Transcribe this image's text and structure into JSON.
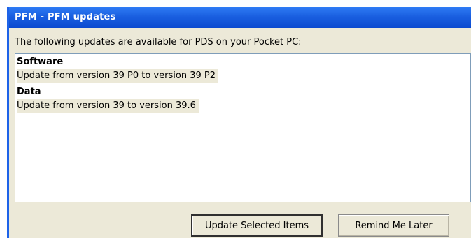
{
  "window": {
    "title": "PFM - PFM updates"
  },
  "intro_text": "The following updates are available for PDS on your Pocket PC:",
  "updates_list": {
    "groups": [
      {
        "header": "Software",
        "items": [
          "Update from version 39 P0 to version 39 P2"
        ]
      },
      {
        "header": "Data",
        "items": [
          "Update from version 39 to version 39.6"
        ]
      }
    ]
  },
  "buttons": {
    "update_selected": "Update Selected Items",
    "remind_later": "Remind Me Later"
  },
  "colors": {
    "title_bar": "#1a5fe0",
    "dialog_background": "#ece9d8",
    "list_background": "#ffffff",
    "item_highlight": "#ece9d8"
  }
}
